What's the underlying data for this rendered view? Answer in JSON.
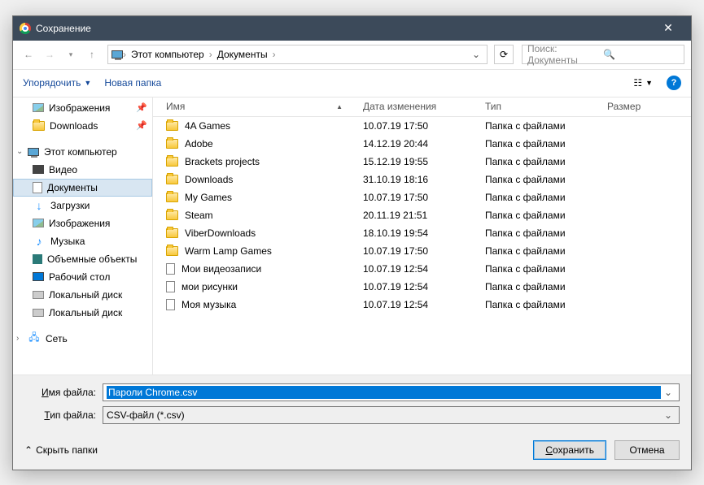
{
  "title": "Сохранение",
  "breadcrumb": {
    "icon": "pc",
    "items": [
      "Этот компьютер",
      "Документы"
    ]
  },
  "search": {
    "placeholder": "Поиск: Документы"
  },
  "toolbar": {
    "organize": "Упорядочить",
    "newfolder": "Новая папка"
  },
  "columns": {
    "name": "Имя",
    "date": "Дата изменения",
    "type": "Тип",
    "size": "Размер"
  },
  "sidebar": {
    "quick": [
      {
        "label": "Изображения",
        "icon": "img",
        "pinned": true
      },
      {
        "label": "Downloads",
        "icon": "folder",
        "pinned": true
      }
    ],
    "pc_label": "Этот компьютер",
    "pc": [
      {
        "label": "Видео",
        "icon": "vid"
      },
      {
        "label": "Документы",
        "icon": "doc",
        "selected": true
      },
      {
        "label": "Загрузки",
        "icon": "dl"
      },
      {
        "label": "Изображения",
        "icon": "img"
      },
      {
        "label": "Музыка",
        "icon": "music"
      },
      {
        "label": "Объемные объекты",
        "icon": "3d"
      },
      {
        "label": "Рабочий стол",
        "icon": "desk"
      },
      {
        "label": "Локальный диск",
        "icon": "disk"
      },
      {
        "label": "Локальный диск",
        "icon": "disk"
      }
    ],
    "net_label": "Сеть"
  },
  "files": [
    {
      "name": "4A Games",
      "date": "10.07.19 17:50",
      "type": "Папка с файлами",
      "icon": "folder"
    },
    {
      "name": "Adobe",
      "date": "14.12.19 20:44",
      "type": "Папка с файлами",
      "icon": "folder"
    },
    {
      "name": "Brackets projects",
      "date": "15.12.19 19:55",
      "type": "Папка с файлами",
      "icon": "folder"
    },
    {
      "name": "Downloads",
      "date": "31.10.19 18:16",
      "type": "Папка с файлами",
      "icon": "folder"
    },
    {
      "name": "My Games",
      "date": "10.07.19 17:50",
      "type": "Папка с файлами",
      "icon": "folder"
    },
    {
      "name": "Steam",
      "date": "20.11.19 21:51",
      "type": "Папка с файлами",
      "icon": "folder"
    },
    {
      "name": "ViberDownloads",
      "date": "18.10.19 19:54",
      "type": "Папка с файлами",
      "icon": "folder"
    },
    {
      "name": "Warm Lamp Games",
      "date": "10.07.19 17:50",
      "type": "Папка с файлами",
      "icon": "folder"
    },
    {
      "name": "Мои видеозаписи",
      "date": "10.07.19 12:54",
      "type": "Папка с файлами",
      "icon": "file"
    },
    {
      "name": "мои рисунки",
      "date": "10.07.19 12:54",
      "type": "Папка с файлами",
      "icon": "file"
    },
    {
      "name": "Моя музыка",
      "date": "10.07.19 12:54",
      "type": "Папка с файлами",
      "icon": "file"
    }
  ],
  "form": {
    "filename_label": "Имя файла:",
    "filename_value": "Пароли Chrome.csv",
    "filetype_label": "Тип файла:",
    "filetype_value": "CSV-файл (*.csv)"
  },
  "footer": {
    "hide": "Скрыть папки",
    "save": "Сохранить",
    "cancel": "Отмена"
  }
}
